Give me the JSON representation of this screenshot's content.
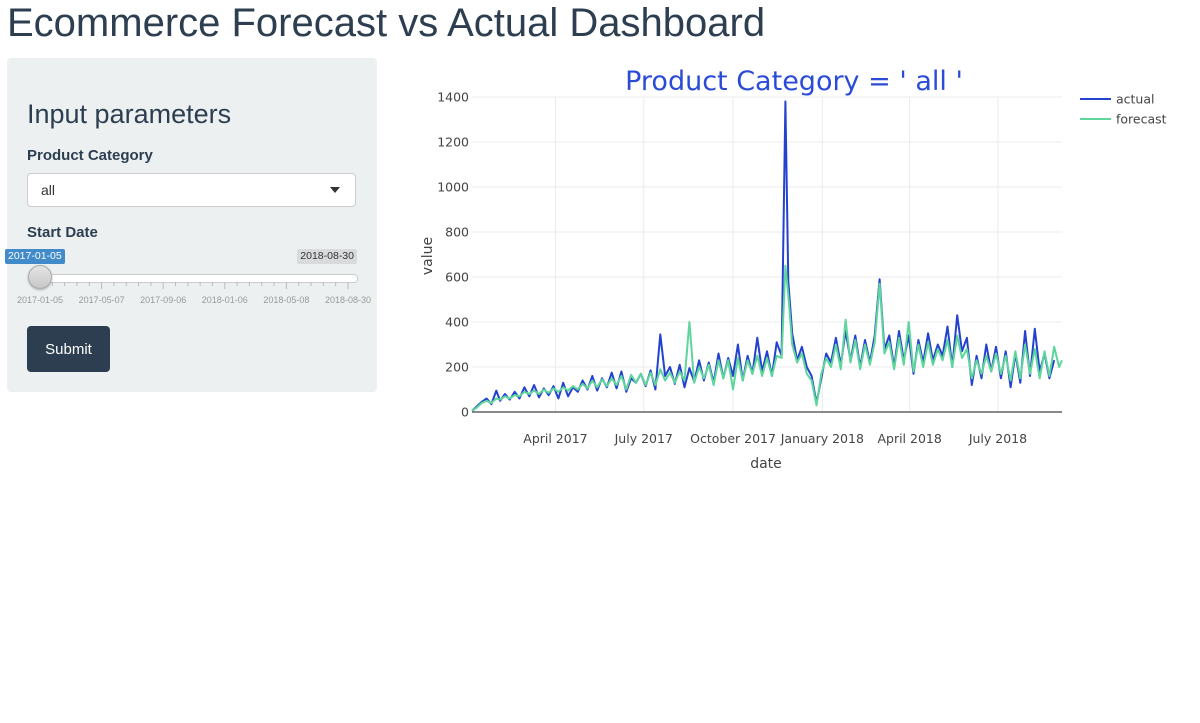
{
  "app": {
    "title": "Ecommerce Forecast vs Actual Dashboard"
  },
  "sidebar": {
    "heading": "Input parameters",
    "product_category": {
      "label": "Product Category",
      "value": "all"
    },
    "start_date": {
      "label": "Start Date",
      "from_value": "2017-01-05",
      "to_value": "2018-08-30",
      "selected_fraction": 0.0,
      "ticks": [
        "2017-01-05",
        "2017-05-07",
        "2017-09-06",
        "2018-01-06",
        "2018-05-08",
        "2018-08-30"
      ]
    },
    "submit_label": "Submit"
  },
  "colors": {
    "actual": "#2442d0",
    "forecast": "#5ed69b",
    "title": "#2a4bd7",
    "navy": "#2c3e50",
    "slider": "#428bca"
  },
  "chart_data": {
    "type": "line",
    "title": "Product Category = ' all '",
    "xlabel": "date",
    "ylabel": "value",
    "xlim": [
      "2017-01-05",
      "2018-09-05"
    ],
    "ylim": [
      0,
      1400
    ],
    "yticks": [
      0,
      200,
      400,
      600,
      800,
      1000,
      1200,
      1400
    ],
    "xticks": [
      {
        "date": "2017-04-01",
        "label": "April 2017"
      },
      {
        "date": "2017-07-01",
        "label": "July 2017"
      },
      {
        "date": "2017-10-01",
        "label": "October 2017"
      },
      {
        "date": "2018-01-01",
        "label": "January 2018"
      },
      {
        "date": "2018-04-01",
        "label": "April 2018"
      },
      {
        "date": "2018-07-01",
        "label": "July 2018"
      }
    ],
    "grid": true,
    "legend_position": "top-right",
    "series": [
      {
        "name": "actual",
        "points": [
          [
            "2017-01-05",
            5
          ],
          [
            "2017-01-10",
            25
          ],
          [
            "2017-01-15",
            45
          ],
          [
            "2017-01-20",
            60
          ],
          [
            "2017-01-25",
            35
          ],
          [
            "2017-01-30",
            95
          ],
          [
            "2017-02-03",
            50
          ],
          [
            "2017-02-08",
            80
          ],
          [
            "2017-02-13",
            55
          ],
          [
            "2017-02-18",
            90
          ],
          [
            "2017-02-23",
            60
          ],
          [
            "2017-02-28",
            110
          ],
          [
            "2017-03-05",
            70
          ],
          [
            "2017-03-10",
            120
          ],
          [
            "2017-03-15",
            65
          ],
          [
            "2017-03-20",
            105
          ],
          [
            "2017-03-25",
            75
          ],
          [
            "2017-03-30",
            115
          ],
          [
            "2017-04-04",
            60
          ],
          [
            "2017-04-09",
            130
          ],
          [
            "2017-04-14",
            70
          ],
          [
            "2017-04-19",
            110
          ],
          [
            "2017-04-24",
            90
          ],
          [
            "2017-04-29",
            140
          ],
          [
            "2017-05-04",
            100
          ],
          [
            "2017-05-09",
            160
          ],
          [
            "2017-05-14",
            95
          ],
          [
            "2017-05-19",
            150
          ],
          [
            "2017-05-24",
            110
          ],
          [
            "2017-05-29",
            175
          ],
          [
            "2017-06-03",
            105
          ],
          [
            "2017-06-08",
            180
          ],
          [
            "2017-06-13",
            90
          ],
          [
            "2017-06-18",
            150
          ],
          [
            "2017-06-23",
            130
          ],
          [
            "2017-06-28",
            170
          ],
          [
            "2017-07-03",
            115
          ],
          [
            "2017-07-08",
            185
          ],
          [
            "2017-07-13",
            100
          ],
          [
            "2017-07-18",
            345
          ],
          [
            "2017-07-23",
            160
          ],
          [
            "2017-07-28",
            200
          ],
          [
            "2017-08-02",
            125
          ],
          [
            "2017-08-07",
            210
          ],
          [
            "2017-08-12",
            110
          ],
          [
            "2017-08-17",
            195
          ],
          [
            "2017-08-22",
            135
          ],
          [
            "2017-08-27",
            230
          ],
          [
            "2017-09-01",
            140
          ],
          [
            "2017-09-06",
            220
          ],
          [
            "2017-09-11",
            130
          ],
          [
            "2017-09-16",
            260
          ],
          [
            "2017-09-21",
            150
          ],
          [
            "2017-09-26",
            240
          ],
          [
            "2017-10-01",
            160
          ],
          [
            "2017-10-06",
            300
          ],
          [
            "2017-10-11",
            140
          ],
          [
            "2017-10-16",
            250
          ],
          [
            "2017-10-21",
            170
          ],
          [
            "2017-10-26",
            330
          ],
          [
            "2017-10-31",
            180
          ],
          [
            "2017-11-05",
            270
          ],
          [
            "2017-11-10",
            160
          ],
          [
            "2017-11-15",
            310
          ],
          [
            "2017-11-20",
            250
          ],
          [
            "2017-11-24",
            1380
          ],
          [
            "2017-11-27",
            580
          ],
          [
            "2017-12-01",
            350
          ],
          [
            "2017-12-06",
            230
          ],
          [
            "2017-12-11",
            290
          ],
          [
            "2017-12-16",
            200
          ],
          [
            "2017-12-21",
            160
          ],
          [
            "2017-12-26",
            40
          ],
          [
            "2017-12-31",
            150
          ],
          [
            "2018-01-05",
            260
          ],
          [
            "2018-01-10",
            220
          ],
          [
            "2018-01-15",
            330
          ],
          [
            "2018-01-20",
            210
          ],
          [
            "2018-01-25",
            360
          ],
          [
            "2018-01-30",
            230
          ],
          [
            "2018-02-04",
            340
          ],
          [
            "2018-02-09",
            200
          ],
          [
            "2018-02-14",
            320
          ],
          [
            "2018-02-19",
            220
          ],
          [
            "2018-02-24",
            340
          ],
          [
            "2018-03-01",
            590
          ],
          [
            "2018-03-06",
            280
          ],
          [
            "2018-03-11",
            340
          ],
          [
            "2018-03-16",
            200
          ],
          [
            "2018-03-21",
            360
          ],
          [
            "2018-03-26",
            230
          ],
          [
            "2018-03-31",
            340
          ],
          [
            "2018-04-05",
            170
          ],
          [
            "2018-04-10",
            320
          ],
          [
            "2018-04-15",
            220
          ],
          [
            "2018-04-20",
            350
          ],
          [
            "2018-04-25",
            230
          ],
          [
            "2018-04-30",
            300
          ],
          [
            "2018-05-05",
            250
          ],
          [
            "2018-05-10",
            380
          ],
          [
            "2018-05-15",
            200
          ],
          [
            "2018-05-20",
            430
          ],
          [
            "2018-05-25",
            270
          ],
          [
            "2018-05-30",
            330
          ],
          [
            "2018-06-04",
            120
          ],
          [
            "2018-06-09",
            250
          ],
          [
            "2018-06-14",
            150
          ],
          [
            "2018-06-19",
            300
          ],
          [
            "2018-06-24",
            180
          ],
          [
            "2018-06-29",
            290
          ],
          [
            "2018-07-04",
            150
          ],
          [
            "2018-07-09",
            270
          ],
          [
            "2018-07-14",
            110
          ],
          [
            "2018-07-19",
            260
          ],
          [
            "2018-07-24",
            130
          ],
          [
            "2018-07-29",
            360
          ],
          [
            "2018-08-03",
            160
          ],
          [
            "2018-08-08",
            370
          ],
          [
            "2018-08-13",
            180
          ],
          [
            "2018-08-18",
            260
          ],
          [
            "2018-08-23",
            150
          ],
          [
            "2018-08-28",
            230
          ]
        ]
      },
      {
        "name": "forecast",
        "points": [
          [
            "2017-01-05",
            5
          ],
          [
            "2017-01-10",
            20
          ],
          [
            "2017-01-15",
            40
          ],
          [
            "2017-01-20",
            50
          ],
          [
            "2017-01-25",
            40
          ],
          [
            "2017-01-30",
            60
          ],
          [
            "2017-02-03",
            55
          ],
          [
            "2017-02-08",
            70
          ],
          [
            "2017-02-13",
            60
          ],
          [
            "2017-02-18",
            75
          ],
          [
            "2017-02-23",
            70
          ],
          [
            "2017-02-28",
            90
          ],
          [
            "2017-03-05",
            80
          ],
          [
            "2017-03-10",
            95
          ],
          [
            "2017-03-15",
            80
          ],
          [
            "2017-03-20",
            100
          ],
          [
            "2017-03-25",
            85
          ],
          [
            "2017-03-30",
            105
          ],
          [
            "2017-04-04",
            90
          ],
          [
            "2017-04-09",
            110
          ],
          [
            "2017-04-14",
            95
          ],
          [
            "2017-04-19",
            115
          ],
          [
            "2017-04-24",
            100
          ],
          [
            "2017-04-29",
            125
          ],
          [
            "2017-05-04",
            105
          ],
          [
            "2017-05-09",
            140
          ],
          [
            "2017-05-14",
            110
          ],
          [
            "2017-05-19",
            145
          ],
          [
            "2017-05-24",
            115
          ],
          [
            "2017-05-29",
            150
          ],
          [
            "2017-06-03",
            120
          ],
          [
            "2017-06-08",
            160
          ],
          [
            "2017-06-13",
            100
          ],
          [
            "2017-06-18",
            165
          ],
          [
            "2017-06-23",
            130
          ],
          [
            "2017-06-28",
            170
          ],
          [
            "2017-07-03",
            120
          ],
          [
            "2017-07-08",
            175
          ],
          [
            "2017-07-13",
            120
          ],
          [
            "2017-07-18",
            190
          ],
          [
            "2017-07-23",
            140
          ],
          [
            "2017-07-28",
            175
          ],
          [
            "2017-08-02",
            130
          ],
          [
            "2017-08-07",
            180
          ],
          [
            "2017-08-12",
            140
          ],
          [
            "2017-08-17",
            400
          ],
          [
            "2017-08-22",
            130
          ],
          [
            "2017-08-27",
            200
          ],
          [
            "2017-09-01",
            150
          ],
          [
            "2017-09-06",
            210
          ],
          [
            "2017-09-11",
            120
          ],
          [
            "2017-09-16",
            230
          ],
          [
            "2017-09-21",
            150
          ],
          [
            "2017-09-26",
            230
          ],
          [
            "2017-10-01",
            100
          ],
          [
            "2017-10-06",
            240
          ],
          [
            "2017-10-11",
            140
          ],
          [
            "2017-10-16",
            230
          ],
          [
            "2017-10-21",
            170
          ],
          [
            "2017-10-26",
            250
          ],
          [
            "2017-10-31",
            160
          ],
          [
            "2017-11-05",
            240
          ],
          [
            "2017-11-10",
            160
          ],
          [
            "2017-11-15",
            250
          ],
          [
            "2017-11-20",
            240
          ],
          [
            "2017-11-24",
            650
          ],
          [
            "2017-11-27",
            520
          ],
          [
            "2017-12-01",
            300
          ],
          [
            "2017-12-06",
            220
          ],
          [
            "2017-12-11",
            260
          ],
          [
            "2017-12-16",
            170
          ],
          [
            "2017-12-21",
            140
          ],
          [
            "2017-12-26",
            30
          ],
          [
            "2017-12-31",
            170
          ],
          [
            "2018-01-05",
            240
          ],
          [
            "2018-01-10",
            200
          ],
          [
            "2018-01-15",
            300
          ],
          [
            "2018-01-20",
            190
          ],
          [
            "2018-01-25",
            410
          ],
          [
            "2018-01-30",
            220
          ],
          [
            "2018-02-04",
            320
          ],
          [
            "2018-02-09",
            190
          ],
          [
            "2018-02-14",
            300
          ],
          [
            "2018-02-19",
            210
          ],
          [
            "2018-02-24",
            310
          ],
          [
            "2018-03-01",
            570
          ],
          [
            "2018-03-06",
            260
          ],
          [
            "2018-03-11",
            310
          ],
          [
            "2018-03-16",
            190
          ],
          [
            "2018-03-21",
            330
          ],
          [
            "2018-03-26",
            210
          ],
          [
            "2018-03-31",
            400
          ],
          [
            "2018-04-05",
            180
          ],
          [
            "2018-04-10",
            300
          ],
          [
            "2018-04-15",
            200
          ],
          [
            "2018-04-20",
            310
          ],
          [
            "2018-04-25",
            210
          ],
          [
            "2018-04-30",
            280
          ],
          [
            "2018-05-05",
            230
          ],
          [
            "2018-05-10",
            320
          ],
          [
            "2018-05-15",
            200
          ],
          [
            "2018-05-20",
            340
          ],
          [
            "2018-05-25",
            240
          ],
          [
            "2018-05-30",
            280
          ],
          [
            "2018-06-04",
            150
          ],
          [
            "2018-06-09",
            230
          ],
          [
            "2018-06-14",
            170
          ],
          [
            "2018-06-19",
            250
          ],
          [
            "2018-06-24",
            180
          ],
          [
            "2018-06-29",
            260
          ],
          [
            "2018-07-04",
            170
          ],
          [
            "2018-07-09",
            250
          ],
          [
            "2018-07-14",
            140
          ],
          [
            "2018-07-19",
            270
          ],
          [
            "2018-07-24",
            150
          ],
          [
            "2018-07-29",
            300
          ],
          [
            "2018-08-03",
            170
          ],
          [
            "2018-08-08",
            280
          ],
          [
            "2018-08-13",
            150
          ],
          [
            "2018-08-18",
            270
          ],
          [
            "2018-08-23",
            160
          ],
          [
            "2018-08-28",
            290
          ],
          [
            "2018-09-02",
            200
          ],
          [
            "2018-09-05",
            230
          ]
        ]
      }
    ]
  }
}
